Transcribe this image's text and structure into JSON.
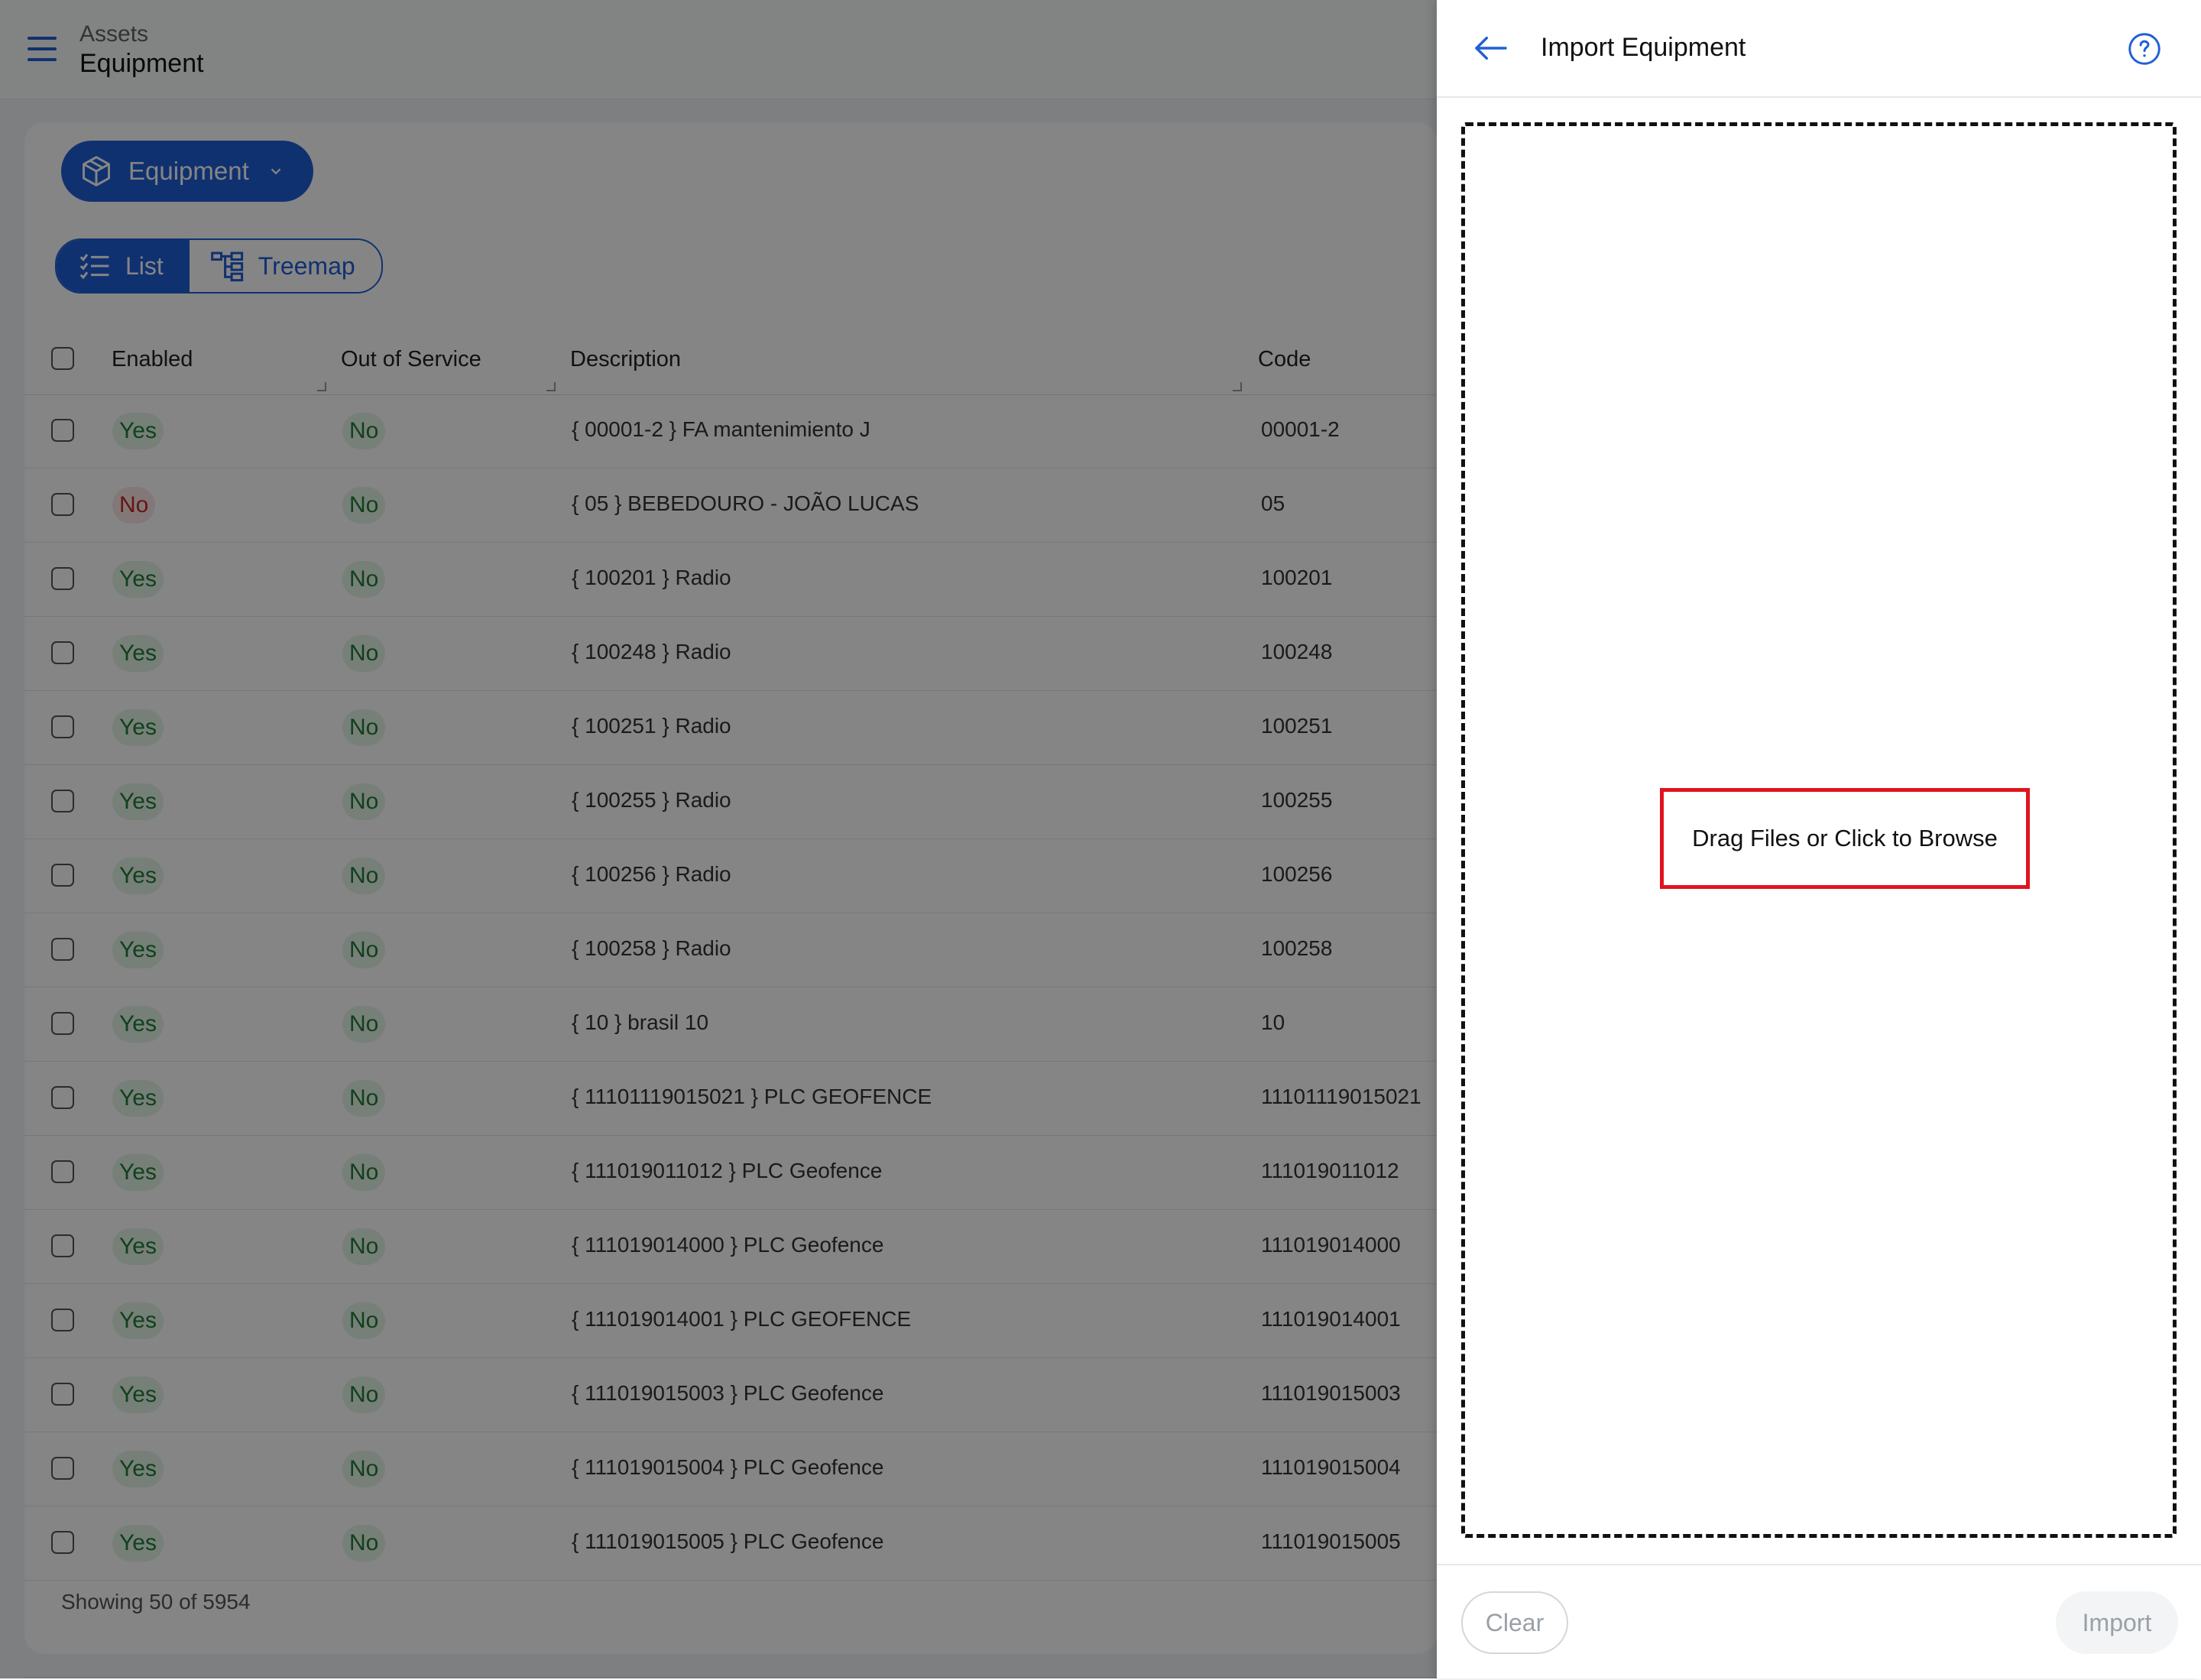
{
  "header": {
    "breadcrumb_parent": "Assets",
    "title": "Equipment"
  },
  "toolbar": {
    "asset_type_label": "Equipment",
    "view_list_label": "List",
    "view_treemap_label": "Treemap"
  },
  "table": {
    "columns": [
      "Enabled",
      "Out of Service",
      "Description",
      "Code"
    ],
    "rows": [
      {
        "enabled": "Yes",
        "out_of_service": "No",
        "description": "{ 00001-2 } FA mantenimiento J",
        "code": "00001-2"
      },
      {
        "enabled": "No",
        "out_of_service": "No",
        "description": "{ 05 } BEBEDOURO - JOÃO LUCAS",
        "code": "05"
      },
      {
        "enabled": "Yes",
        "out_of_service": "No",
        "description": "{ 100201 } Radio",
        "code": "100201"
      },
      {
        "enabled": "Yes",
        "out_of_service": "No",
        "description": "{ 100248 } Radio",
        "code": "100248"
      },
      {
        "enabled": "Yes",
        "out_of_service": "No",
        "description": "{ 100251 } Radio",
        "code": "100251"
      },
      {
        "enabled": "Yes",
        "out_of_service": "No",
        "description": "{ 100255 } Radio",
        "code": "100255"
      },
      {
        "enabled": "Yes",
        "out_of_service": "No",
        "description": "{ 100256 } Radio",
        "code": "100256"
      },
      {
        "enabled": "Yes",
        "out_of_service": "No",
        "description": "{ 100258 } Radio",
        "code": "100258"
      },
      {
        "enabled": "Yes",
        "out_of_service": "No",
        "description": "{ 10 } brasil 10",
        "code": "10"
      },
      {
        "enabled": "Yes",
        "out_of_service": "No",
        "description": "{ 11101119015021 } PLC GEOFENCE",
        "code": "11101119015021"
      },
      {
        "enabled": "Yes",
        "out_of_service": "No",
        "description": "{ 111019011012 } PLC Geofence",
        "code": "111019011012"
      },
      {
        "enabled": "Yes",
        "out_of_service": "No",
        "description": "{ 111019014000 } PLC Geofence",
        "code": "111019014000"
      },
      {
        "enabled": "Yes",
        "out_of_service": "No",
        "description": "{ 111019014001 } PLC GEOFENCE",
        "code": "111019014001"
      },
      {
        "enabled": "Yes",
        "out_of_service": "No",
        "description": "{ 111019015003 } PLC Geofence",
        "code": "111019015003"
      },
      {
        "enabled": "Yes",
        "out_of_service": "No",
        "description": "{ 111019015004 } PLC Geofence",
        "code": "111019015004"
      },
      {
        "enabled": "Yes",
        "out_of_service": "No",
        "description": "{ 111019015005 } PLC Geofence",
        "code": "111019015005"
      }
    ],
    "footer": "Showing 50 of 5954"
  },
  "drawer": {
    "title": "Import Equipment",
    "dropzone_text": "Drag Files or Click to Browse",
    "clear_label": "Clear",
    "import_label": "Import"
  },
  "colors": {
    "primary": "#1f5fd6",
    "yes": "#1e7d33",
    "no_disabled": "#c62828",
    "highlight": "#e0141e"
  }
}
